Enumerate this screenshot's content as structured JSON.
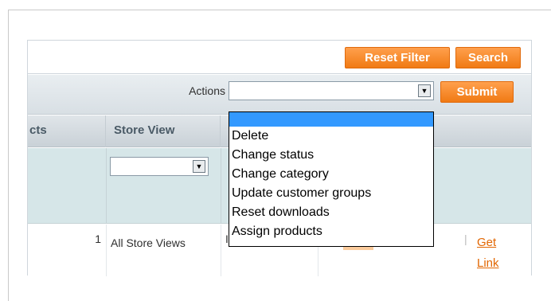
{
  "toolbar": {
    "reset_filter_label": "Reset Filter",
    "search_label": "Search"
  },
  "actions": {
    "label": "Actions",
    "selected_value": "",
    "submit_label": "Submit",
    "options": [
      "",
      "Delete",
      "Change status",
      "Change category",
      "Update customer groups",
      "Reset downloads",
      "Assign products"
    ]
  },
  "table": {
    "headers": [
      "cts",
      "Store View"
    ],
    "rows": [
      {
        "count": "1",
        "store_view": "All Store Views",
        "partial_mark": "I",
        "link_download": "oad",
        "link_separator": "|",
        "link_get": "Get Link"
      }
    ]
  },
  "colors": {
    "accent": "#f07a14",
    "selected_option": "#3399ff",
    "link": "#e26703"
  },
  "icons": {
    "select_arrow": "chevron-down-icon"
  }
}
